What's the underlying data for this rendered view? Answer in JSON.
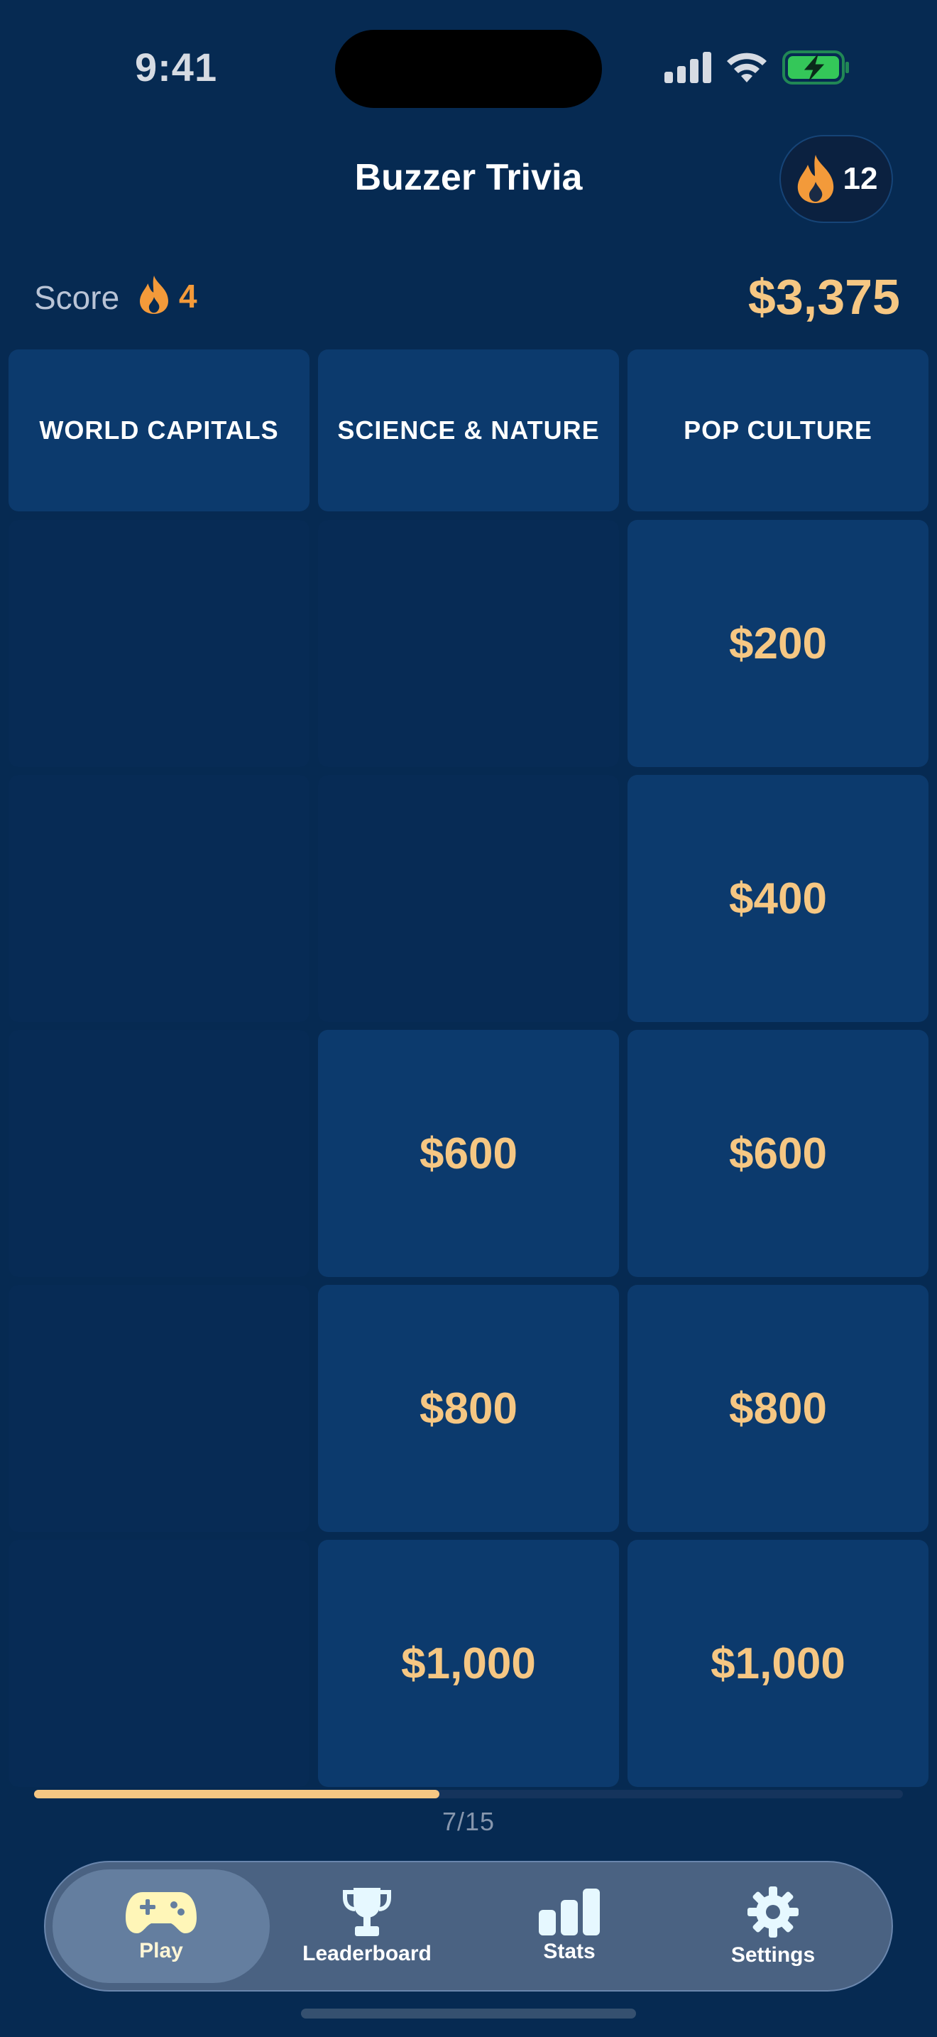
{
  "status_bar": {
    "time": "9:41"
  },
  "header": {
    "title": "Buzzer Trivia",
    "streak_count": "12"
  },
  "score_row": {
    "label": "Score",
    "streak": "4",
    "total": "$3,375"
  },
  "board": {
    "categories": [
      {
        "name": "WORLD CAPITALS",
        "cells": [
          "",
          "",
          "",
          "",
          ""
        ]
      },
      {
        "name": "SCIENCE & NATURE",
        "cells": [
          "",
          "",
          "$600",
          "$800",
          "$1,000"
        ]
      },
      {
        "name": "POP CULTURE",
        "cells": [
          "$200",
          "$400",
          "$600",
          "$800",
          "$1,000"
        ]
      }
    ]
  },
  "progress": {
    "text": "7/15",
    "answered": 7,
    "total": 15
  },
  "tabbar": {
    "tabs": [
      {
        "label": "Play",
        "icon": "gamepad-icon",
        "active": true
      },
      {
        "label": "Leaderboard",
        "icon": "trophy-icon",
        "active": false
      },
      {
        "label": "Stats",
        "icon": "bar-chart-icon",
        "active": false
      },
      {
        "label": "Settings",
        "icon": "gear-icon",
        "active": false
      }
    ]
  },
  "colors": {
    "background": "#062a52",
    "tile": "#0c3a6d",
    "value_gold": "#f6c783",
    "flame_orange": "#f39a3a",
    "battery_green": "#34c759"
  }
}
